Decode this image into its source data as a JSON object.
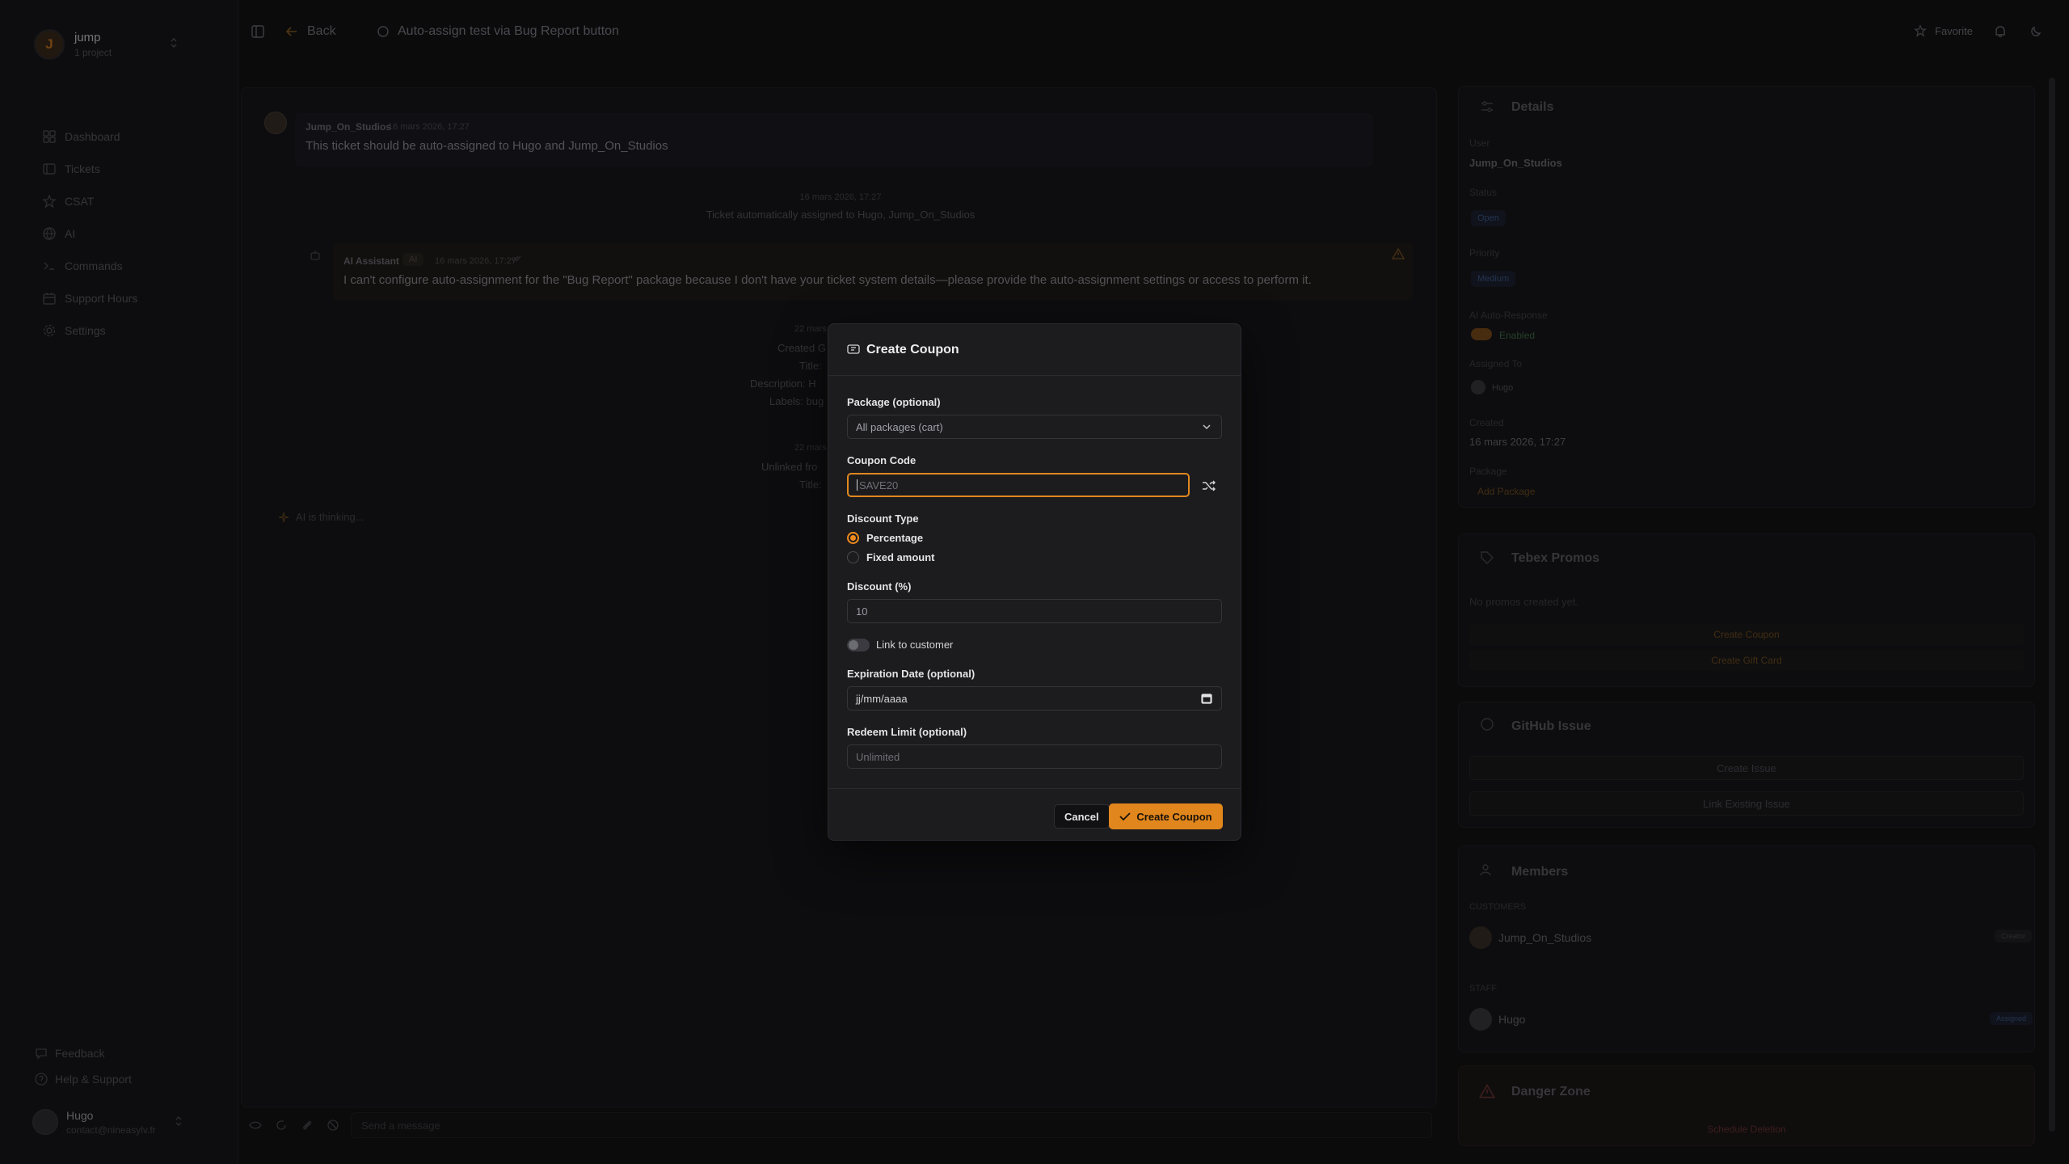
{
  "workspace": {
    "name": "jump",
    "subtitle": "1 project",
    "initial": "J"
  },
  "sidebar": {
    "items": [
      {
        "label": "Dashboard",
        "icon": "grid-icon"
      },
      {
        "label": "Tickets",
        "icon": "ticket-icon"
      },
      {
        "label": "CSAT",
        "icon": "star-icon"
      },
      {
        "label": "AI",
        "icon": "globe-icon"
      },
      {
        "label": "Commands",
        "icon": "terminal-icon"
      },
      {
        "label": "Support Hours",
        "icon": "calendar-icon"
      },
      {
        "label": "Settings",
        "icon": "gear-icon"
      }
    ],
    "feedback": "Feedback",
    "help": "Help & Support",
    "user": {
      "name": "Hugo",
      "email": "contact@nineasylv.fr"
    }
  },
  "topbar": {
    "back": "Back",
    "ticket_title": "Auto-assign test via Bug Report button",
    "favorite": "Favorite"
  },
  "chat": {
    "msg1": {
      "author": "Jump_On_Studios",
      "time": "16 mars 2026, 17:27",
      "text": "This ticket should be auto-assigned to Hugo and Jump_On_Studios"
    },
    "sys1": {
      "time": "16 mars 2026, 17:27",
      "text": "Ticket automatically assigned to Hugo, Jump_On_Studios"
    },
    "msg2": {
      "author": "AI Assistant",
      "badge": "AI",
      "time": "16 mars 2026, 17:27",
      "text": "I can't configure auto-assignment for the \"Bug Report\" package because I don't have your ticket system details—please provide the auto-assignment settings or access to perform it."
    },
    "sys2": {
      "time": "22 mars",
      "line1": "Created G",
      "line2": "Title:",
      "line3": "Description: H",
      "line4": "Labels: bug"
    },
    "sys3": {
      "time": "22 mars",
      "line1": "Unlinked fro",
      "line2": "Title:"
    },
    "thinking": "AI is thinking...",
    "composer_placeholder": "Send a message"
  },
  "details": {
    "title": "Details",
    "user_label": "User",
    "user_value": "Jump_On_Studios",
    "status_label": "Status",
    "status_value": "Open",
    "priority_label": "Priority",
    "priority_value": "Medium",
    "ai_label": "AI Auto-Response",
    "ai_value": "Enabled",
    "assigned_label": "Assigned To",
    "assigned_value": "Hugo",
    "created_label": "Created",
    "created_value": "16 mars 2026, 17:27",
    "package_label": "Package",
    "package_value": "Add Package"
  },
  "promos": {
    "title": "Tebex Promos",
    "empty": "No promos created yet.",
    "create_coupon": "Create Coupon",
    "create_gift": "Create Gift Card"
  },
  "github": {
    "title": "GitHub Issue",
    "create": "Create Issue",
    "link": "Link Existing Issue"
  },
  "members": {
    "title": "Members",
    "customers_label": "CUSTOMERS",
    "customer": {
      "name": "Jump_On_Studios",
      "badge": "Creator"
    },
    "staff_label": "STAFF",
    "staff": {
      "name": "Hugo",
      "badge": "Assigned"
    }
  },
  "danger": {
    "title": "Danger Zone",
    "action": "Schedule Deletion"
  },
  "modal": {
    "title": "Create Coupon",
    "package_label": "Package (optional)",
    "package_value": "All packages (cart)",
    "code_label": "Coupon Code",
    "code_placeholder": "SAVE20",
    "discount_type_label": "Discount Type",
    "type_percentage": "Percentage",
    "type_fixed": "Fixed amount",
    "discount_label": "Discount (%)",
    "discount_value": "10",
    "link_customer": "Link to customer",
    "expiration_label": "Expiration Date (optional)",
    "expiration_value": "jj/mm/aaaa",
    "redeem_label": "Redeem Limit (optional)",
    "redeem_placeholder": "Unlimited",
    "cancel": "Cancel",
    "submit": "Create Coupon"
  },
  "colors": {
    "accent": "#e0861d",
    "background": "#141416",
    "modal": "#1c1c1f"
  }
}
